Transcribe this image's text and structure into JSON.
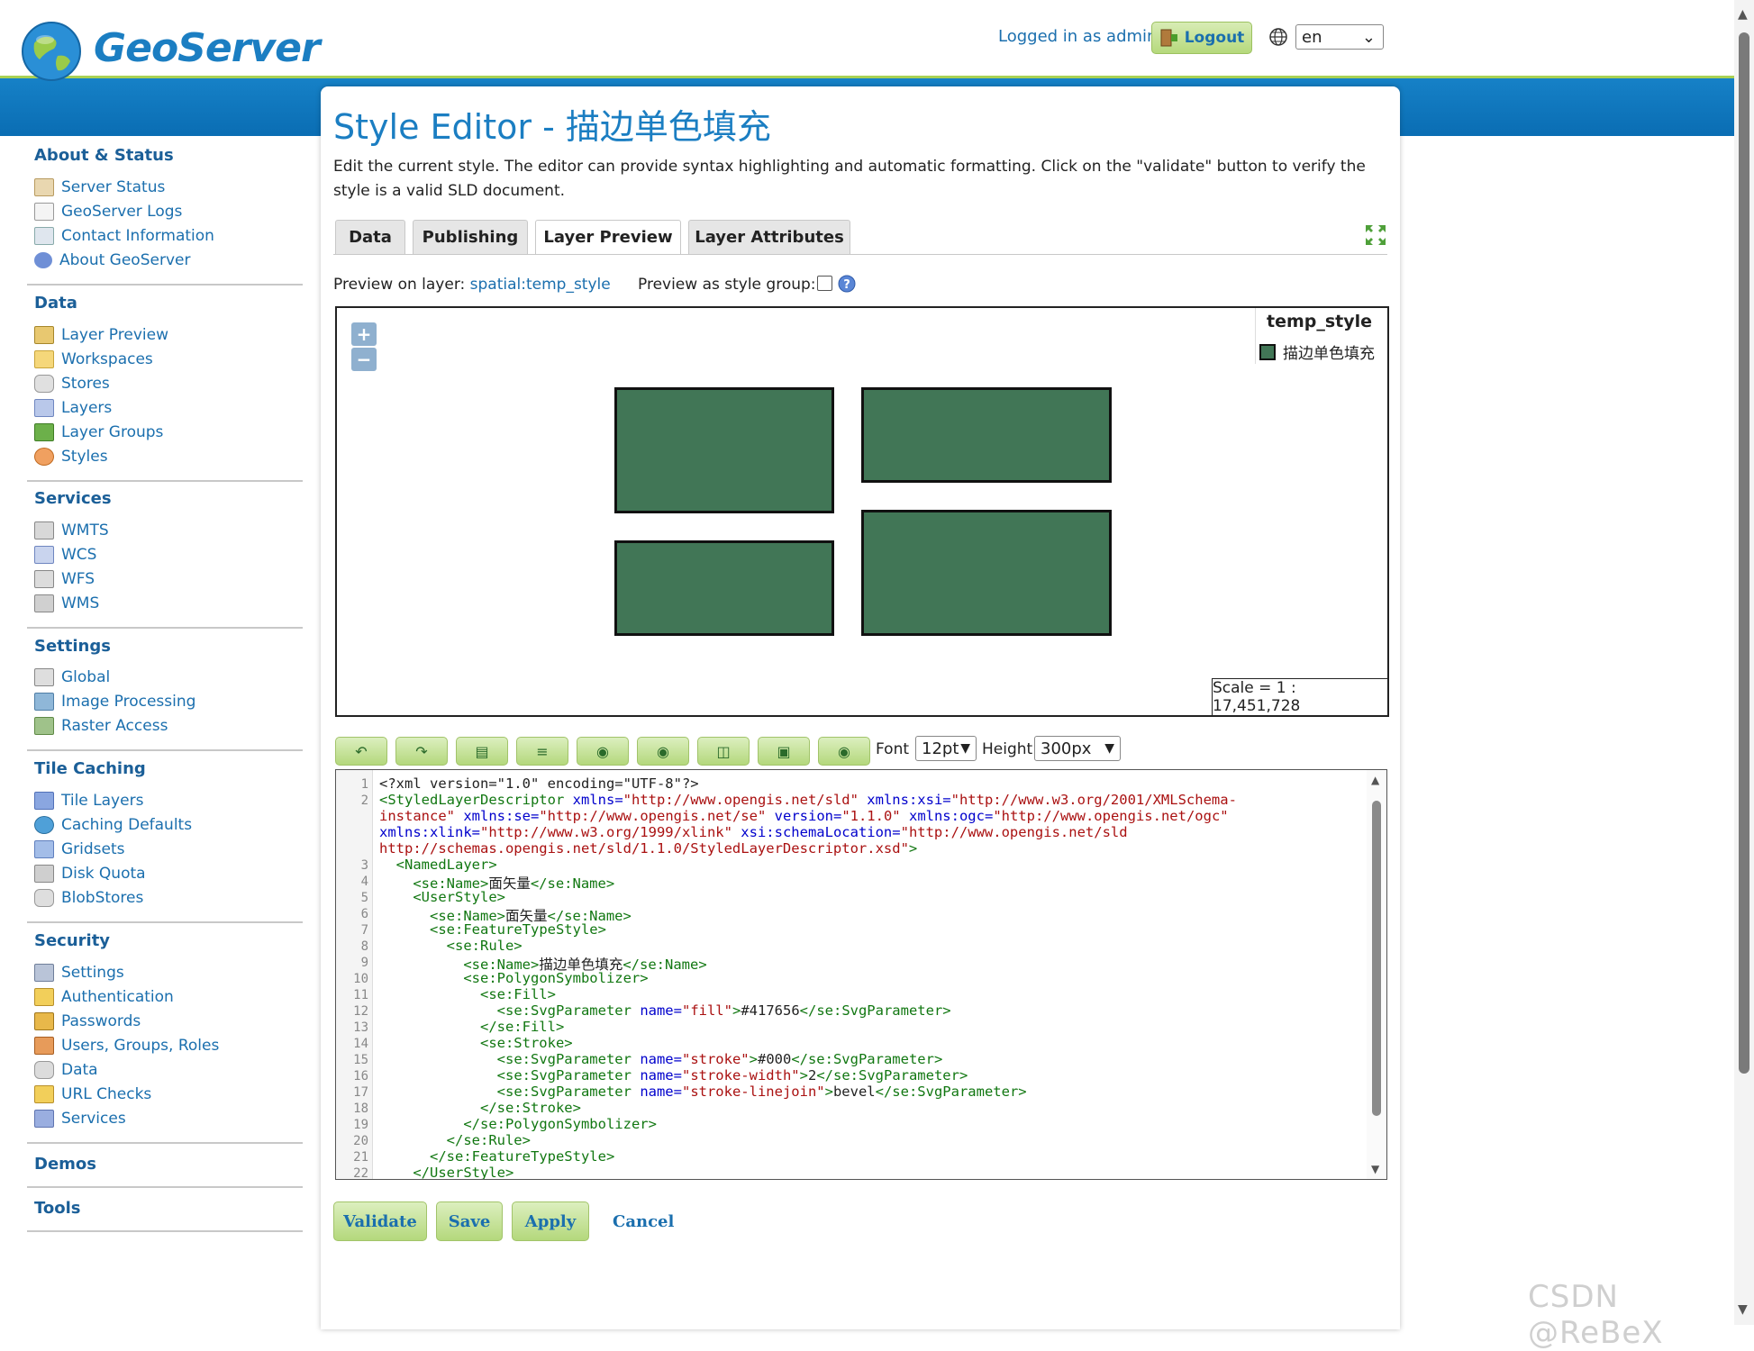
{
  "header": {
    "logo_text": "GeoServer",
    "logged_in_text": "Logged in as admin.",
    "logout_label": "Logout",
    "language_value": "en"
  },
  "sidebar": {
    "sections": [
      {
        "title": "About & Status",
        "items": [
          "Server Status",
          "GeoServer Logs",
          "Contact Information",
          "About GeoServer"
        ]
      },
      {
        "title": "Data",
        "items": [
          "Layer Preview",
          "Workspaces",
          "Stores",
          "Layers",
          "Layer Groups",
          "Styles"
        ]
      },
      {
        "title": "Services",
        "items": [
          "WMTS",
          "WCS",
          "WFS",
          "WMS"
        ]
      },
      {
        "title": "Settings",
        "items": [
          "Global",
          "Image Processing",
          "Raster Access"
        ]
      },
      {
        "title": "Tile Caching",
        "items": [
          "Tile Layers",
          "Caching Defaults",
          "Gridsets",
          "Disk Quota",
          "BlobStores"
        ]
      },
      {
        "title": "Security",
        "items": [
          "Settings",
          "Authentication",
          "Passwords",
          "Users, Groups, Roles",
          "Data",
          "URL Checks",
          "Services"
        ]
      },
      {
        "title": "Demos",
        "items": []
      },
      {
        "title": "Tools",
        "items": []
      }
    ]
  },
  "main": {
    "title": "Style Editor - 描边单色填充",
    "description": "Edit the current style. The editor can provide syntax highlighting and automatic formatting. Click on the \"validate\" button to verify the style is a valid SLD document.",
    "tabs": [
      "Data",
      "Publishing",
      "Layer Preview",
      "Layer Attributes"
    ],
    "active_tab": "Layer Preview",
    "preview_on_label": "Preview on layer:",
    "preview_layer": "spatial:temp_style",
    "preview_group_label": "Preview as style group:",
    "map": {
      "legend_title": "temp_style",
      "legend_item": "描边单色填充",
      "legend_color": "#417656",
      "scale_text": "Scale = 1 : 17,451,728",
      "zoom_in": "+",
      "zoom_out": "−"
    },
    "toolbar": {
      "font_label": "Font",
      "font_value": "12pt",
      "height_label": "Height",
      "height_value": "300px"
    },
    "code_line_numbers": [
      "1",
      "2",
      "",
      "",
      "",
      "3",
      "4",
      "5",
      "6",
      "7",
      "8",
      "9",
      "10",
      "11",
      "12",
      "13",
      "14",
      "15",
      "16",
      "17",
      "18",
      "19",
      "20",
      "21",
      "22"
    ],
    "buttons": {
      "validate": "Validate",
      "save": "Save",
      "apply": "Apply",
      "cancel": "Cancel"
    }
  },
  "colors": {
    "accent_blue": "#1b7ec2",
    "band_blue": "#0a6db3",
    "fill": "#417656",
    "stroke": "#000"
  },
  "watermark": "CSDN @ReBeX"
}
